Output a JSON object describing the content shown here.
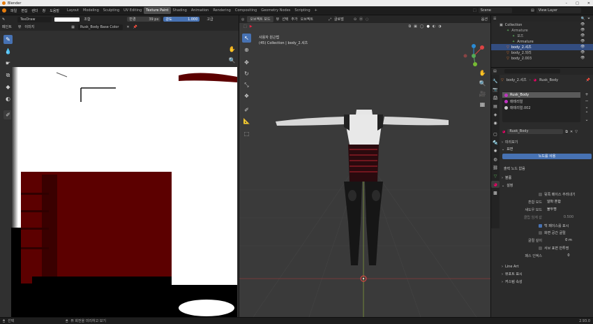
{
  "title_bar": {
    "app_title": "Blender",
    "window_controls": [
      "–",
      "□",
      "✕"
    ]
  },
  "menus": [
    "파일",
    "편집",
    "렌더",
    "창",
    "도움말"
  ],
  "workspace_tabs": [
    "Layout",
    "Modeling",
    "Sculpting",
    "UV Editing",
    "Texture Paint",
    "Shading",
    "Animation",
    "Rendering",
    "Compositing",
    "Geometry Nodes",
    "Scripting",
    "+"
  ],
  "active_workspace": "Texture Paint",
  "scene": {
    "label": "Scene",
    "view_layer": "View Layer"
  },
  "image_editor": {
    "brush_name": "TexDraw",
    "blend": "조합",
    "radius_label": "반경",
    "radius_value": "39 px",
    "strength_label": "강도",
    "strength_value": "1.000",
    "advanced": "고급",
    "view_menu": "뷰",
    "image_menu": "이미지",
    "header_menu": "페인트",
    "image_name": "Rusk_Body Base Color"
  },
  "viewport": {
    "mode": "오브젝트 모드",
    "menu_view": "뷰",
    "menu_select": "선택",
    "menu_add": "추가",
    "menu_object": "오브젝트",
    "orientation": "글로벌",
    "view_name": "사용자 원근법",
    "view_info": "(45) Collection | body_2.셔츠",
    "options": "옵션"
  },
  "outliner": {
    "items": [
      {
        "name": "Collection",
        "indent": 0,
        "icon": "▣",
        "color": "#c0c0c0"
      },
      {
        "name": "Armature",
        "indent": 1,
        "icon": "✦",
        "color": "#5aa55a"
      },
      {
        "name": "포즈",
        "indent": 2,
        "icon": "✦",
        "color": "#5aa55a"
      },
      {
        "name": "Armature",
        "indent": 2,
        "icon": "✦",
        "color": "#5aa55a"
      },
      {
        "name": "body_2.셔츠",
        "indent": 1,
        "icon": "▽",
        "color": "#e07a3a"
      },
      {
        "name": "body_2.외리",
        "indent": 1,
        "icon": "▽",
        "color": "#e07a3a"
      },
      {
        "name": "body_2.003",
        "indent": 1,
        "icon": "▽",
        "color": "#e07a3a"
      }
    ]
  },
  "properties": {
    "object_name": "body_2.셔츠",
    "material_name": "Rusk_Body",
    "slots": [
      {
        "name": "Rusk_Body",
        "color": "#c034c0"
      },
      {
        "name": "매테리얼",
        "color": "#c034c0"
      },
      {
        "name": "매테리얼.002",
        "color": "#cccccc"
      }
    ],
    "material_field": "Rusk_Body",
    "sections": {
      "preview": "미리보기",
      "surface": "표면",
      "use_nodes_button": "노드를 사용",
      "node_note": "출력 노드 없음",
      "volume": "볼륨",
      "settings": "설정",
      "line_art": "Line Art",
      "viewport_display": "뷰포트 표시",
      "custom_props": "커스텀 속성"
    },
    "backface_culling": "뒷쪽 페이스 추려내기",
    "blend_mode_label": "혼합 모드",
    "blend_mode_value": "알파 혼합",
    "shadow_mode_label": "섀도우 모드",
    "shadow_mode_value": "불투명",
    "clip_threshold_label": "클립 임계 값",
    "clip_threshold_value": "0.500",
    "show_backface": "백 페이스를 표시",
    "screen_space_refraction": "화면 공간 굴절",
    "refraction_depth_label": "굴절 깊이",
    "refraction_depth_value": "0 m",
    "subsurface_translucency": "서브 표면 반투명",
    "pass_index_label": "패스 인덱스",
    "pass_index_value": "0"
  },
  "status_bar": {
    "left": "선택",
    "middle": "뷰 회전을 미리하고 보기",
    "version": "2.93.0"
  },
  "colors": {
    "active_tab": "#4d4d4d",
    "accent": "#4772b3",
    "texture_red": "#5c0000",
    "viewport_bg": "#3a3a3a"
  }
}
